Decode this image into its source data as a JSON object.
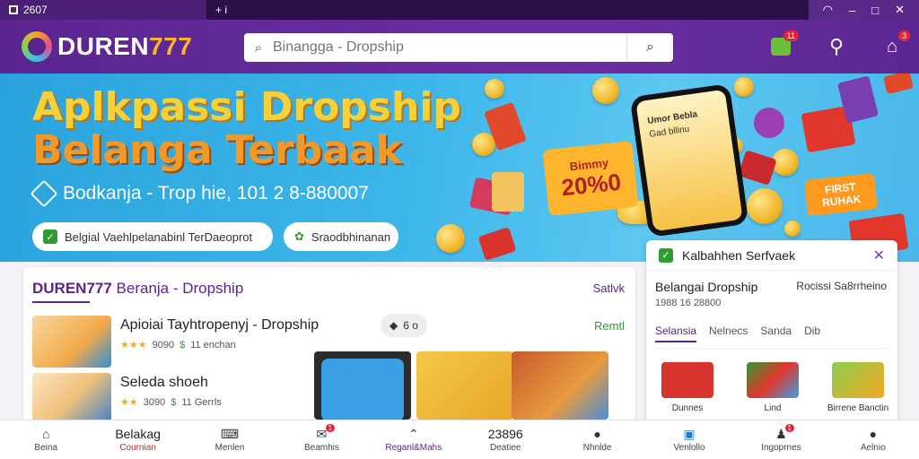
{
  "titlebar": {
    "app_label": "2607",
    "tab_label": "+ i"
  },
  "header": {
    "logo_main": "DUREN",
    "logo_num": "777",
    "search_placeholder": "Binangga - Dropship",
    "cart_badge": "11",
    "user_badge": "3"
  },
  "banner": {
    "title_line1": "Aplkpassi Dropship",
    "title_line2": "Belanga Terbaak",
    "subtitle": "Bodkanja - Trop hie, 101 2 8-880007",
    "btn1_label": "Belgial Vaehlpelanabinl TerDaeoprot",
    "btn2_label": "Sraodbhinanan",
    "promo_top": "Bimmy",
    "promo_big": "20%0",
    "badge_label": "FIRST RUHAK",
    "phone_text1": "Umor Bebla",
    "phone_text2": "Gad bllinu"
  },
  "card": {
    "title_brand": "DUREN777",
    "title_rest": " Beranja - Dropship",
    "link_label": "Satlvk",
    "products": [
      {
        "title": "Apioiai Tayhtropenyj - Dropship",
        "rating": "★★★",
        "price": "9090",
        "meta2": "11 enchan",
        "badge": "6 o"
      },
      {
        "title": "Seleda shoeh",
        "rating": "★★",
        "price": "3090",
        "meta2": "11 Gerrls",
        "badge": ""
      }
    ],
    "cta_label": "Remtl"
  },
  "side": {
    "header": "Kalbahhen Serfvaek",
    "row1_left": "Belangai Dropship",
    "row1_right": "Rocissi Sa8rrheino",
    "row2": "1988 16 28800",
    "tabs": [
      "Selansia",
      "Nelnecs",
      "Sanda",
      "Dib"
    ],
    "items": [
      {
        "label": "Dunnes"
      },
      {
        "label": "Lind"
      },
      {
        "label": "Birrene Banctin"
      }
    ]
  },
  "bottom_nav": [
    {
      "label": "Beina",
      "icon": "home-icon"
    },
    {
      "label": "Bemand",
      "icon": "text",
      "top": "Belakag",
      "red": "Cournian"
    },
    {
      "label": "Menlen",
      "icon": "gamepad-icon"
    },
    {
      "label": "Beamhis",
      "icon": "chat-icon",
      "badge": "1"
    },
    {
      "label": "Reganl&Mahs",
      "icon": "up-icon"
    },
    {
      "label": "Deatiee",
      "icon": "text",
      "top": "23896"
    },
    {
      "label": "Nhnlde",
      "icon": "user-icon"
    },
    {
      "label": "Venlollo",
      "icon": "shop-icon"
    },
    {
      "label": "Ingoprnes",
      "icon": "bell-icon",
      "badge": "1"
    },
    {
      "label": "Aelnio",
      "icon": "account-icon"
    }
  ]
}
